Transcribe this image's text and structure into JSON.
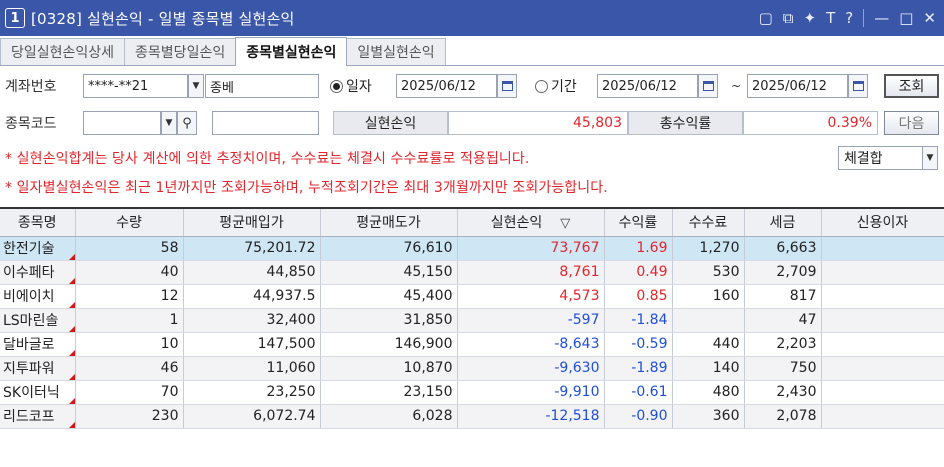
{
  "window": {
    "number": "1",
    "title": "[0328] 실현손익 - 일별 종목별 실현손익",
    "icons": [
      "window-mode-icon",
      "detach-icon",
      "pin-icon",
      "font-icon",
      "help-icon",
      "minimize-icon",
      "maximize-icon",
      "close-icon"
    ],
    "icon_glyphs": [
      "▢",
      "⧉",
      "✦",
      "T",
      "?",
      "—",
      "□",
      "✕"
    ]
  },
  "tabs": [
    {
      "label": "당일실현손익상세",
      "active": false
    },
    {
      "label": "종목별당일손익",
      "active": false
    },
    {
      "label": "종목별실현손익",
      "active": true
    },
    {
      "label": "일별실현손익",
      "active": false
    }
  ],
  "form": {
    "account_label": "계좌번호",
    "account_value": "****-**21",
    "account_type": "종베",
    "radio_date_label": "일자",
    "date_value": "2025/06/12",
    "radio_period_label": "기간",
    "period_start": "2025/06/12",
    "period_sep": "~",
    "period_end": "2025/06/12",
    "query_button": "조회",
    "code_label": "종목코드",
    "code_value": "",
    "code_name": "",
    "realized_label": "실현손익",
    "realized_value": "45,803",
    "return_label": "총수익률",
    "return_value": "0.39%",
    "next_button": "다음",
    "notice1": "* 실현손익합계는 당사 계산에 의한 추정치이며, 수수료는 체결시 수수료률로 적용됩니다.",
    "notice2": "* 일자별실현손익은 최근 1년까지만 조회가능하며, 누적조회기간은 최대 3개월까지만 조회가능합니다.",
    "basis_select": "체결합"
  },
  "table": {
    "columns": [
      "종목명",
      "수량",
      "평균매입가",
      "평균매도가",
      "실현손익",
      "수익률",
      "수수료",
      "세금",
      "신용이자"
    ],
    "sort_indicator": "▽",
    "rows": [
      {
        "name": "한전기술",
        "qty": "58",
        "buy": "75,201.72",
        "sell": "76,610",
        "pnl": "73,767",
        "rate": "1.69",
        "fee": "1,270",
        "tax": "6,663",
        "interest": "",
        "sign": "pos"
      },
      {
        "name": "이수페타",
        "qty": "40",
        "buy": "44,850",
        "sell": "45,150",
        "pnl": "8,761",
        "rate": "0.49",
        "fee": "530",
        "tax": "2,709",
        "interest": "",
        "sign": "pos"
      },
      {
        "name": "비에이치",
        "qty": "12",
        "buy": "44,937.5",
        "sell": "45,400",
        "pnl": "4,573",
        "rate": "0.85",
        "fee": "160",
        "tax": "817",
        "interest": "",
        "sign": "pos"
      },
      {
        "name": "LS마린솔",
        "qty": "1",
        "buy": "32,400",
        "sell": "31,850",
        "pnl": "-597",
        "rate": "-1.84",
        "fee": "",
        "tax": "47",
        "interest": "",
        "sign": "neg"
      },
      {
        "name": "달바글로",
        "qty": "10",
        "buy": "147,500",
        "sell": "146,900",
        "pnl": "-8,643",
        "rate": "-0.59",
        "fee": "440",
        "tax": "2,203",
        "interest": "",
        "sign": "neg"
      },
      {
        "name": "지투파워",
        "qty": "46",
        "buy": "11,060",
        "sell": "10,870",
        "pnl": "-9,630",
        "rate": "-1.89",
        "fee": "140",
        "tax": "750",
        "interest": "",
        "sign": "neg"
      },
      {
        "name": "SK이터닉",
        "qty": "70",
        "buy": "23,250",
        "sell": "23,150",
        "pnl": "-9,910",
        "rate": "-0.61",
        "fee": "480",
        "tax": "2,430",
        "interest": "",
        "sign": "neg"
      },
      {
        "name": "리드코프",
        "qty": "230",
        "buy": "6,072.74",
        "sell": "6,028",
        "pnl": "-12,518",
        "rate": "-0.90",
        "fee": "360",
        "tax": "2,078",
        "interest": "",
        "sign": "neg"
      }
    ]
  },
  "colors": {
    "titlebar": "#3a56a8",
    "positive": "#e0262c",
    "negative": "#1f4fd6",
    "selected_row": "#cfe7f5"
  }
}
